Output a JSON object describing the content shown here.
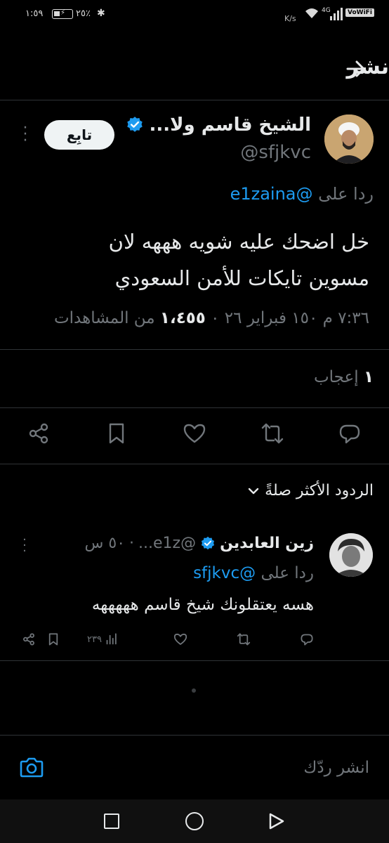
{
  "status_bar": {
    "time": "١:٥٩",
    "battery": "٢٥٪",
    "network_speed": "K/s",
    "network_type": "4G",
    "vowifi": "VoWiFi"
  },
  "header": {
    "title": "نشر",
    "back_icon": "arrow-right-icon"
  },
  "tweet": {
    "author_name": "الشيخ قاسم ولا...",
    "author_handle": "@sfjkvc",
    "verified_color": "#1d9bf0",
    "follow_label": "تابِع",
    "reply_prefix": "ردا على",
    "reply_mention": "@e1zaina",
    "text_line1": "خل اضحك عليه شويه هههه لان",
    "text_line2": "مسوين تايكات للأمن السعودي",
    "timestamp": "٧:٣٦ م ١٥٠ فبراير ٢٦ ٠",
    "views_count": "١،٤٥٥",
    "views_label": "من المشاهدات",
    "likes_count": "١",
    "likes_label": "إعجاب",
    "actions": [
      "reply-icon",
      "retweet-icon",
      "like-icon",
      "bookmark-icon",
      "share-icon"
    ]
  },
  "sort": {
    "label": "الردود الأكثر صلةً"
  },
  "reply": {
    "author_name": "زين العابدين",
    "author_handle": "@e1z...",
    "time_ago": "٥٠ س",
    "reply_prefix": "ردا على",
    "reply_mention": "@sfjkvc",
    "text": "هسه يعتقلونك شيخ قاسم هههههه",
    "views": "٢٣٩"
  },
  "composer": {
    "placeholder": "انشر ردّك"
  },
  "colors": {
    "accent": "#1d9bf0",
    "background": "#000000",
    "muted": "#71767b"
  }
}
